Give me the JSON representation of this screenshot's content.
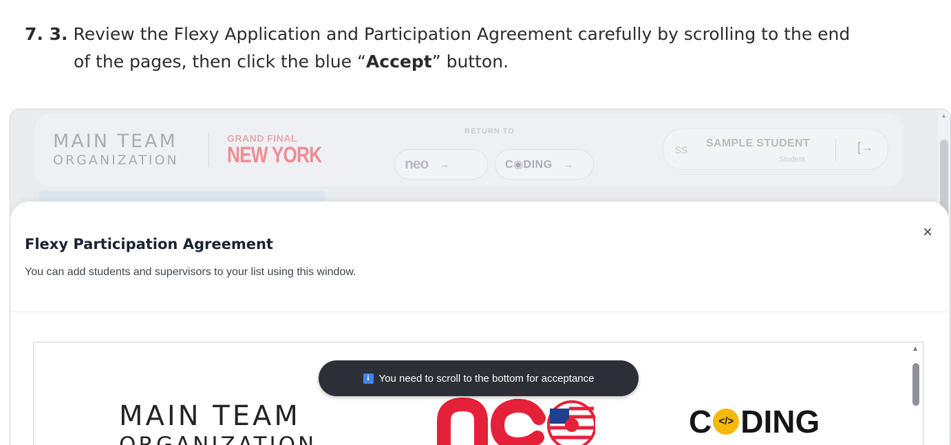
{
  "instruction": {
    "step_number": "7. 3.",
    "line1": "Review the Flexy Application and Participation Agreement carefully by scrolling to the end",
    "line2_pre": "of the pages, then click the blue “",
    "line2_bold": "Accept",
    "line2_post": "” button."
  },
  "app_header": {
    "logo_line1": "MAIN TEAM",
    "logo_line2": "ORGANIZATION",
    "event_line1": "GRAND FINAL",
    "event_line2": "NEW YORK",
    "return_label": "RETURN TO",
    "return_links": [
      {
        "label": "neo"
      },
      {
        "label": "C◉DING"
      }
    ],
    "user_initials": "SS",
    "user_name": "SAMPLE STUDENT",
    "user_role": "Student"
  },
  "modal": {
    "title": "Flexy Participation Agreement",
    "subtitle": "You can add students and supervisors to your list using this window.",
    "close_label": "×"
  },
  "document": {
    "logo_main_line1": "MAIN TEAM",
    "logo_main_line2": "ORGANIZATION",
    "coding_text_pre": "C",
    "coding_badge": "</>",
    "coding_text_post": "DING"
  },
  "toast": {
    "icon": "i",
    "message": "You need to scroll to the bottom for acceptance"
  },
  "colors": {
    "toast_bg": "#2c2f35",
    "info_blue": "#3f86e8",
    "neo_red": "#e5213a",
    "coding_yellow": "#f5b90a"
  }
}
